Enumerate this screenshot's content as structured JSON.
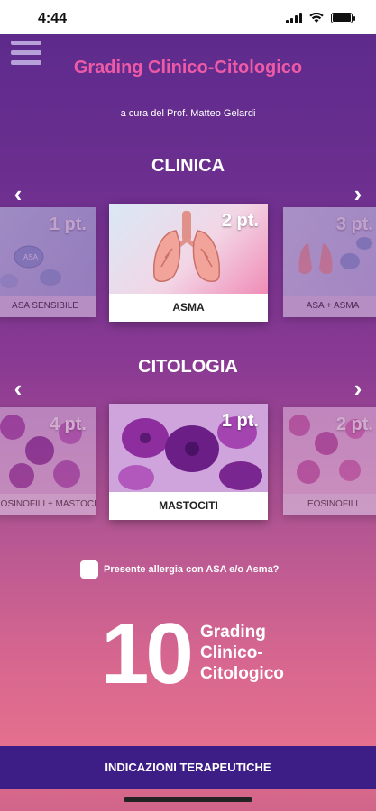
{
  "status": {
    "time": "4:44"
  },
  "header": {
    "title": "Grading Clinico-Citologico",
    "subtitle": "a cura del Prof. Matteo Gelardi"
  },
  "clinica": {
    "title": "CLINICA",
    "cards": [
      {
        "label": "ASA SENSIBILE",
        "points": "1 pt."
      },
      {
        "label": "ASMA",
        "points": "2 pt."
      },
      {
        "label": "ASA + ASMA",
        "points": "3 pt."
      }
    ]
  },
  "citologia": {
    "title": "CITOLOGIA",
    "cards": [
      {
        "label": "EOSINOFILI + MASTOCITI",
        "points": "4 pt."
      },
      {
        "label": "MASTOCITI",
        "points": "1 pt."
      },
      {
        "label": "EOSINOFILI",
        "points": "2 pt."
      }
    ]
  },
  "allergy_checkbox": {
    "label": "Presente allergia con ASA e/o Asma?",
    "checked": false
  },
  "grading": {
    "value": "10",
    "label_line1": "Grading",
    "label_line2": "Clinico-",
    "label_line3": "Citologico"
  },
  "footer": {
    "button_label": "INDICAZIONI TERAPEUTICHE"
  },
  "colors": {
    "title_pink": "#ef5aa6",
    "button_purple": "#3d1d86"
  },
  "icons": {
    "menu": "hamburger-icon",
    "prev": "chevron-left-icon",
    "next": "chevron-right-icon",
    "signal": "signal-icon",
    "wifi": "wifi-icon",
    "battery": "battery-icon"
  }
}
